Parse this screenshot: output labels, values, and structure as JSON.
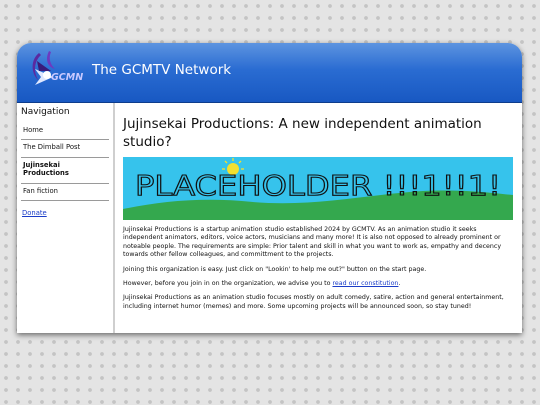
{
  "header": {
    "logo_text": "GCMN",
    "site_title": "The GCMTV Network"
  },
  "sidebar": {
    "heading": "Navigation",
    "items": [
      {
        "label": "Home"
      },
      {
        "label": "The Dimball Post"
      },
      {
        "label": "Jujinsekai Productions",
        "active": true
      },
      {
        "label": "Fan fiction"
      }
    ],
    "donate_label": "Donate"
  },
  "main": {
    "title": "Jujinsekai Productions: A new independent animation studio?",
    "banner_text": "PLACEHOLDER !!!1!!1!",
    "paragraphs": [
      "Jujinsekai Productions is a startup animation studio established 2024 by GCMTV. As an animation studio it seeks independent animators, editors, voice actors, musicians and many more! It is also not opposed to already prominent or noteable people. The requirements are simple: Prior talent and skill in what you want to work as, empathy and decency towards other fellow colleagues, and committment to the projects.",
      "Joining this organization is easy. Just click on \"Lookin' to help me out?\" button on the start page."
    ],
    "constitution_before": "However, before you join in on the organization, we advise you to ",
    "constitution_link": "read our constitution",
    "constitution_after": ".",
    "closing_paragraph": "Jujinsekai Productions as an animation studio focuses mostly on adult comedy, satire, action and general entertainment, including internet humor (memes) and more. Some upcoming projects will be announced soon, so stay tuned!"
  },
  "colors": {
    "header_blue": "#2a6cd2",
    "link": "#1a3cc8",
    "banner_sky": "#36c3ec",
    "banner_grass": "#34a84e"
  }
}
